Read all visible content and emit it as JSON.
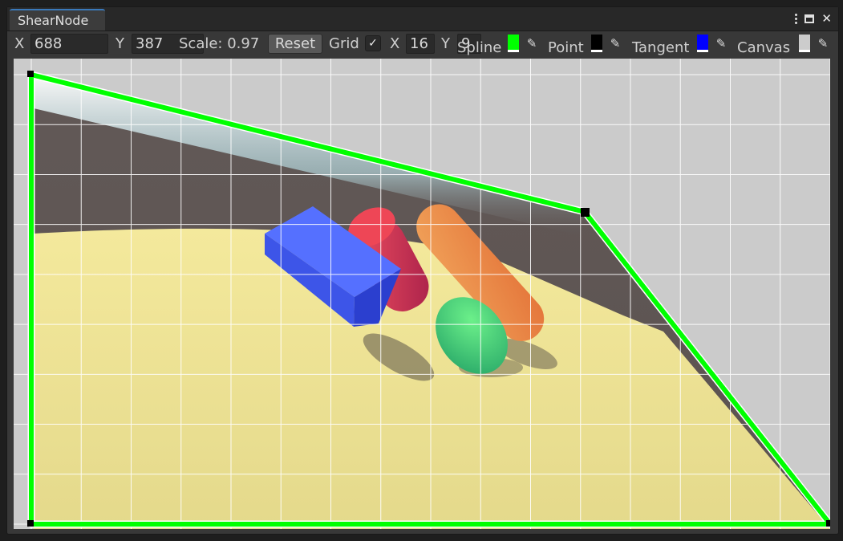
{
  "window": {
    "tab_title": "ShearNode",
    "controls": [
      "kebab-menu",
      "maximize",
      "close"
    ]
  },
  "toolbar": {
    "x_label": "X",
    "x_value": "688",
    "y_label": "Y",
    "y_value": "387",
    "scale_label": "Scale: 0.97",
    "reset_label": "Reset",
    "grid_label": "Grid",
    "grid_checked": true,
    "grid_x_label": "X",
    "grid_x_value": "16",
    "grid_y_label": "Y",
    "grid_y_value": "9",
    "spline_label": "Spline",
    "spline_color": "#00ff00",
    "point_label": "Point",
    "point_color": "#000000",
    "tangent_label": "Tangent",
    "tangent_color": "#0000ff",
    "canvas_label": "Canvas",
    "canvas_color": "#cccccc"
  },
  "canvas": {
    "grid_columns": 16,
    "grid_rows": 9,
    "spline_color": "#00ff00",
    "point_color": "#000000",
    "background_color": "#cbcbcb",
    "scene": "sheared 3D scene: yellow floor, dark backdrop, blue box, red cylinder, orange capsule, green ellipsoid"
  }
}
